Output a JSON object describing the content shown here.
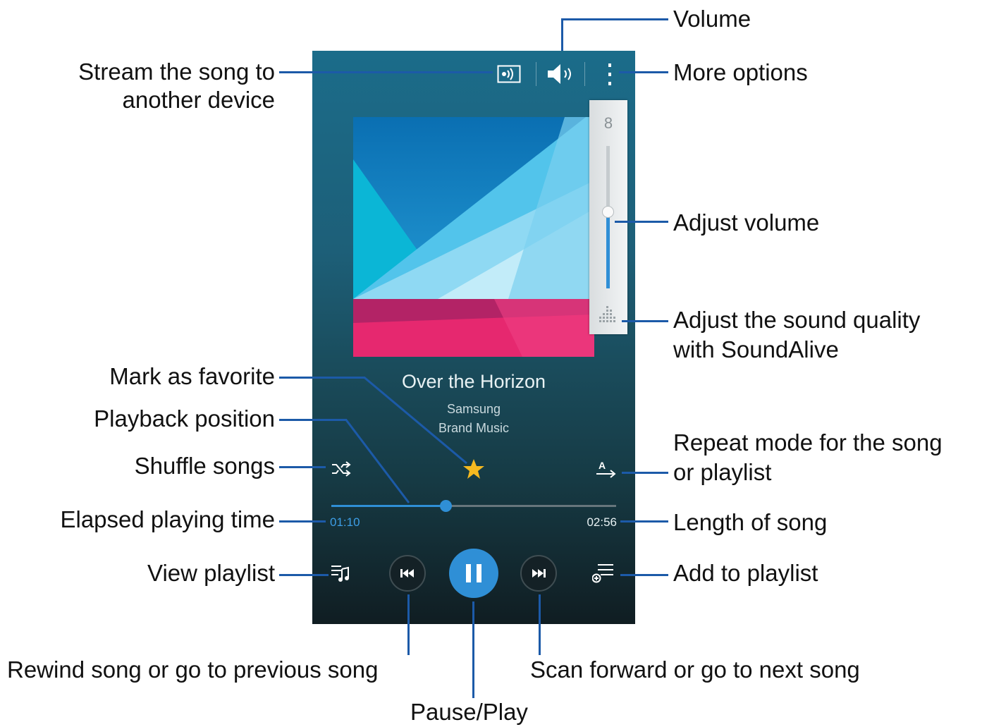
{
  "player": {
    "song_title": "Over the Horizon",
    "artist": "Samsung",
    "album": "Brand Music",
    "elapsed_time": "01:10",
    "total_time": "02:56",
    "progress_fraction": 0.4,
    "volume_level": "8",
    "volume_fraction": 0.54
  },
  "callouts": {
    "volume": "Volume",
    "stream_line1": "Stream the song to",
    "stream_line2": "another device",
    "more_options": "More options",
    "adjust_volume": "Adjust volume",
    "soundalive_line1": "Adjust the sound quality",
    "soundalive_line2": "with SoundAlive",
    "mark_favorite": "Mark as favorite",
    "playback_position": "Playback position",
    "shuffle": "Shuffle songs",
    "repeat_line1": "Repeat mode for the song",
    "repeat_line2": "or playlist",
    "elapsed": "Elapsed playing time",
    "length": "Length of song",
    "view_playlist": "View playlist",
    "add_playlist": "Add to playlist",
    "rewind": "Rewind song or go to previous song",
    "forward": "Scan forward or go to next song",
    "pause_play": "Pause/Play"
  },
  "icons": [
    "stream-icon",
    "volume-icon",
    "more-options-icon",
    "soundalive-icon",
    "favorite-star-icon",
    "shuffle-icon",
    "repeat-icon",
    "playlist-icon",
    "previous-icon",
    "pause-icon",
    "next-icon",
    "add-to-playlist-icon"
  ],
  "colors": {
    "accent": "#2f8fd6",
    "callout_line": "#1c5aa8",
    "star": "#f5b920"
  }
}
